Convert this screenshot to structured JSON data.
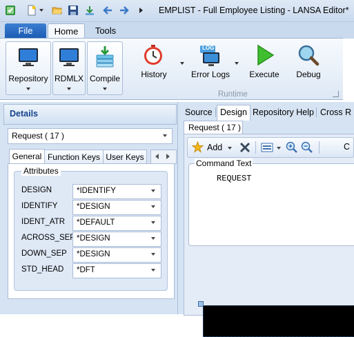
{
  "window": {
    "title": "EMPLIST - Full Employee Listing - LANSA Editor*"
  },
  "quick_access": {
    "icons": [
      "lansa-app-icon",
      "new-document-icon",
      "open-folder-icon",
      "save-icon",
      "download-icon",
      "back-arrow-icon",
      "forward-arrow-icon",
      "more-arrow-icon"
    ]
  },
  "ribbon": {
    "tabs": {
      "file": "File",
      "home": "Home",
      "tools": "Tools"
    },
    "buttons": {
      "repository": "Repository",
      "rdmlx": "RDMLX",
      "compile": "Compile",
      "history": "History",
      "error_logs": "Error Logs",
      "execute": "Execute",
      "debug": "Debug"
    },
    "error_logs_badge": "LOG",
    "group_label": "Runtime"
  },
  "details": {
    "title": "Details",
    "object_value": "Request ( 17 )",
    "tabs": {
      "general": "General",
      "function_keys": "Function Keys",
      "user_keys": "User Keys"
    },
    "attributes_label": "Attributes",
    "attributes": [
      {
        "name": "DESIGN",
        "value": "*IDENTIFY"
      },
      {
        "name": "IDENTIFY",
        "value": "*DESIGN"
      },
      {
        "name": "IDENT_ATR",
        "value": "*DEFAULT"
      },
      {
        "name": "ACROSS_SEP",
        "value": "*DESIGN"
      },
      {
        "name": "DOWN_SEP",
        "value": "*DESIGN"
      },
      {
        "name": "STD_HEAD",
        "value": "*DFT"
      }
    ]
  },
  "editor": {
    "tabs": {
      "source": "Source",
      "design": "Design",
      "repository_help": "Repository Help",
      "cross_ref": "Cross R"
    },
    "document_tab": "Request ( 17 )",
    "toolbar": {
      "add": "Add",
      "cut_label": "C"
    },
    "command_text_label": "Command Text",
    "command_text": "REQUEST"
  },
  "colors": {
    "accent": "#1c5cb4",
    "panel": "#d6e3f3",
    "border": "#a9bcd6"
  }
}
